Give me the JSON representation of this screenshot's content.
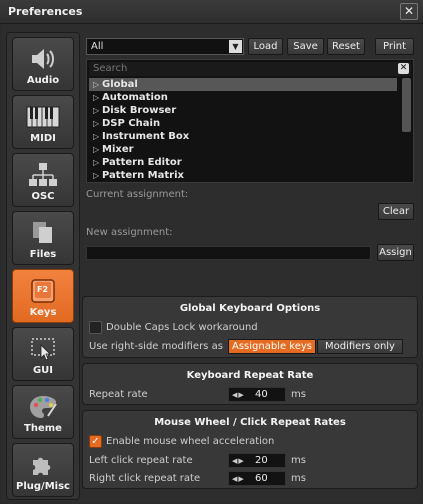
{
  "window": {
    "title": "Preferences",
    "close_glyph": "✕"
  },
  "sidebar": {
    "items": [
      {
        "label": "Audio",
        "icon": "speaker-icon",
        "active": false
      },
      {
        "label": "MIDI",
        "icon": "piano-keys-icon",
        "active": false
      },
      {
        "label": "OSC",
        "icon": "network-icon",
        "active": false
      },
      {
        "label": "Files",
        "icon": "files-icon",
        "active": false
      },
      {
        "label": "Keys",
        "icon": "function-key-icon",
        "active": true,
        "key_glyph": "F2"
      },
      {
        "label": "GUI",
        "icon": "cursor-window-icon",
        "active": false
      },
      {
        "label": "Theme",
        "icon": "palette-icon",
        "active": false
      },
      {
        "label": "Plug/Misc",
        "icon": "puzzle-icon",
        "active": false
      }
    ]
  },
  "keys": {
    "filter_select": {
      "value": "All"
    },
    "toolbar": {
      "load": "Load",
      "save": "Save",
      "reset": "Reset",
      "print": "Print"
    },
    "search": {
      "placeholder": "Search",
      "clear_glyph": "✕"
    },
    "tree": [
      {
        "label": "Global",
        "selected": true
      },
      {
        "label": "Automation",
        "selected": false
      },
      {
        "label": "Disk Browser",
        "selected": false
      },
      {
        "label": "DSP Chain",
        "selected": false
      },
      {
        "label": "Instrument Box",
        "selected": false
      },
      {
        "label": "Mixer",
        "selected": false
      },
      {
        "label": "Pattern Editor",
        "selected": false
      },
      {
        "label": "Pattern Matrix",
        "selected": false
      }
    ],
    "current_assignment_label": "Current assignment:",
    "clear_button": "Clear",
    "new_assignment_label": "New assignment:",
    "new_assignment_value": "",
    "assign_button": "Assign"
  },
  "global_keyboard_options": {
    "title": "Global Keyboard Options",
    "double_caps_lock": {
      "label": "Double Caps Lock workaround",
      "checked": false
    },
    "right_modifiers": {
      "label": "Use right-side modifiers as",
      "options": [
        "Assignable keys",
        "Modifiers only"
      ],
      "selected": "Assignable keys"
    }
  },
  "keyboard_repeat_rate": {
    "title": "Keyboard Repeat Rate",
    "repeat_rate": {
      "label": "Repeat rate",
      "value": "40",
      "unit": "ms"
    }
  },
  "mouse_wheel": {
    "title": "Mouse Wheel / Click Repeat Rates",
    "acceleration": {
      "label": "Enable mouse wheel acceleration",
      "checked": true
    },
    "left_click": {
      "label": "Left click repeat rate",
      "value": "20",
      "unit": "ms"
    },
    "right_click": {
      "label": "Right click repeat rate",
      "value": "60",
      "unit": "ms"
    }
  },
  "colors": {
    "accent": "#e56b22",
    "background": "#2d2d2d",
    "panel": "#383838"
  }
}
